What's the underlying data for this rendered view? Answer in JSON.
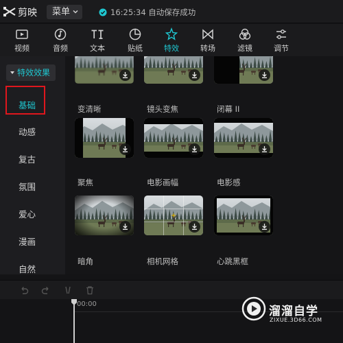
{
  "app": {
    "name": "剪映",
    "menu_label": "菜单",
    "save_status": "16:25:34 自动保存成功"
  },
  "tools": [
    {
      "label": "视频",
      "icon": "video-icon"
    },
    {
      "label": "音频",
      "icon": "audio-icon"
    },
    {
      "label": "文本",
      "icon": "text-icon"
    },
    {
      "label": "贴纸",
      "icon": "sticker-icon"
    },
    {
      "label": "特效",
      "icon": "effects-icon",
      "active": true
    },
    {
      "label": "转场",
      "icon": "transition-icon"
    },
    {
      "label": "滤镜",
      "icon": "filter-icon"
    },
    {
      "label": "调节",
      "icon": "adjust-icon"
    }
  ],
  "sidebar": {
    "header": "特效效果",
    "items": [
      "基础",
      "动感",
      "复古",
      "氛围",
      "爱心",
      "漫画",
      "自然"
    ],
    "active_index": 0
  },
  "effects": [
    {
      "name": "变清晰"
    },
    {
      "name": "镜头变焦"
    },
    {
      "name": "闭幕 II"
    },
    {
      "name": "聚焦"
    },
    {
      "name": "电影画幅"
    },
    {
      "name": "电影感"
    },
    {
      "name": "暗角"
    },
    {
      "name": "相机网格"
    },
    {
      "name": "心跳黑框"
    }
  ],
  "timeline": {
    "time": "00:00"
  },
  "watermark": {
    "title": "溜溜自学",
    "url": "ZIXUE.3D66.COM"
  },
  "colors": {
    "accent": "#1fc6d0",
    "highlight_box": "#e0161d"
  }
}
